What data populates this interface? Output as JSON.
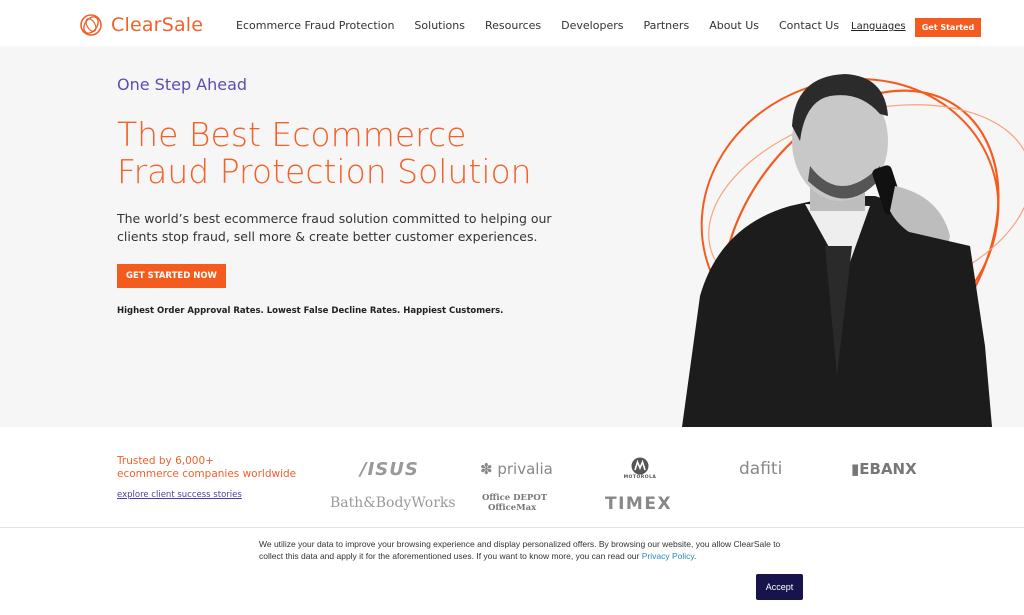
{
  "brand": {
    "name": "ClearSale",
    "color": "#f2612a"
  },
  "nav": {
    "links": [
      "Ecommerce Fraud Protection",
      "Solutions",
      "Resources",
      "Developers",
      "Partners",
      "About Us",
      "Contact Us"
    ],
    "languages": "Languages",
    "cta": "Get Started"
  },
  "hero": {
    "eyebrow": "One Step Ahead",
    "headline_line1": "The Best Ecommerce",
    "headline_line2": "Fraud Protection Solution",
    "subtext": "The world’s best ecommerce fraud solution committed to helping our clients stop fraud, sell more & create better customer experiences.",
    "cta": "GET STARTED NOW",
    "tagline": "Highest Order Approval Rates. Lowest False Decline Rates. Happiest Customers."
  },
  "trust": {
    "title_line1": "Trusted by 6,000+",
    "title_line2": "ecommerce companies worldwide",
    "link": "explore client success stories",
    "logos": {
      "asus": "/ISUS",
      "privalia": "privalia",
      "motorola": "MOTOROLA",
      "dafiti": "dafiti",
      "ebanx": "EBANX",
      "bbw": "Bath&BodyWorks",
      "od1": "Office DEPOT",
      "od2": "OfficeMax",
      "timex": "TIMEX"
    }
  },
  "cookie": {
    "text_before": "We utilize your data to improve your browsing experience and display personalized offers. By browsing our website, you allow ClearSale to collect this data and apply it for the aforementioned uses. If you want to know more, you can read our ",
    "link": "Privacy Policy",
    "text_after": ".",
    "accept": "Accept"
  }
}
